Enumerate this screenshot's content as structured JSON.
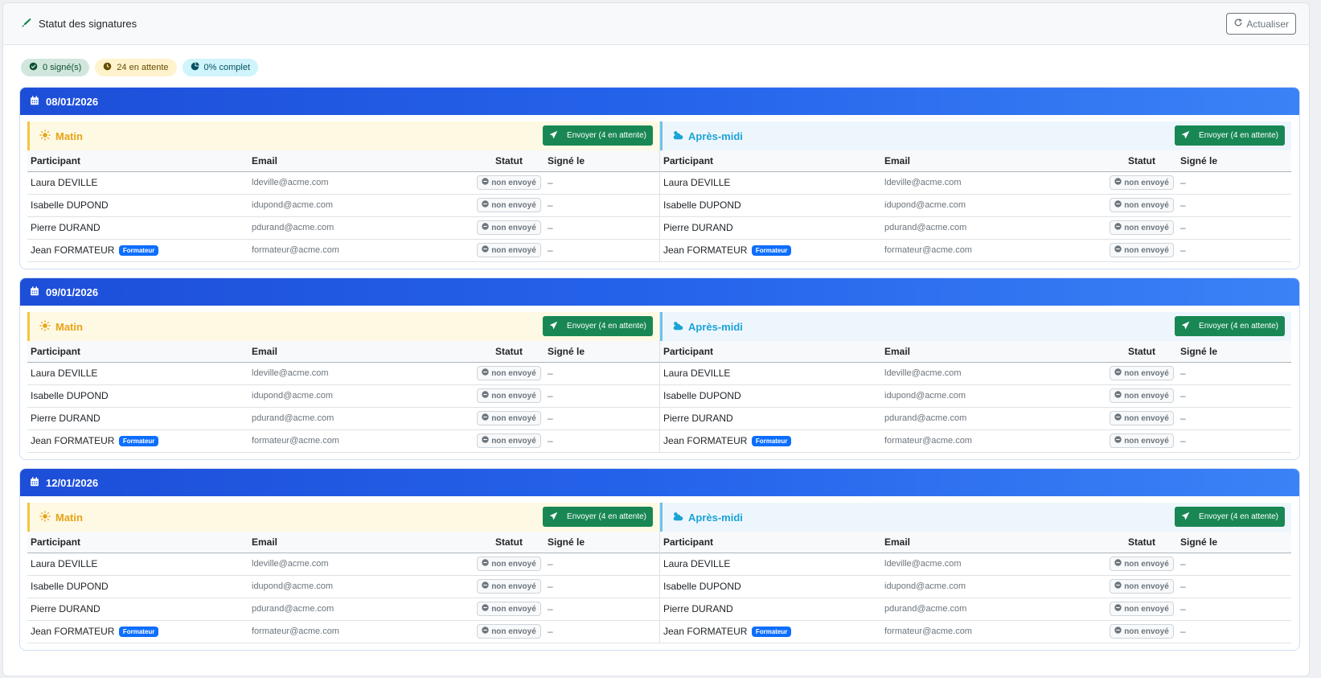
{
  "header": {
    "title": "Statut des signatures",
    "refresh_label": "Actualiser"
  },
  "summary": {
    "signed": "0 signé(s)",
    "pending": "24 en attente",
    "complete": "0% complet"
  },
  "send_label": "Envoyer (4 en attente)",
  "columns": {
    "participant": "Participant",
    "email": "Email",
    "status": "Statut",
    "signed_at": "Signé le"
  },
  "periods": {
    "morning": "Matin",
    "afternoon": "Après-midi"
  },
  "status_label": "non envoyé",
  "trainer_badge": "Formateur",
  "empty_value": "–",
  "participants": [
    {
      "name": "Laura DEVILLE",
      "email": "ldeville@acme.com",
      "trainer": false
    },
    {
      "name": "Isabelle DUPOND",
      "email": "idupond@acme.com",
      "trainer": false
    },
    {
      "name": "Pierre DURAND",
      "email": "pdurand@acme.com",
      "trainer": false
    },
    {
      "name": "Jean FORMATEUR",
      "email": "formateur@acme.com",
      "trainer": true
    }
  ],
  "days": [
    {
      "date": "08/01/2026"
    },
    {
      "date": "09/01/2026"
    },
    {
      "date": "12/01/2026"
    }
  ]
}
